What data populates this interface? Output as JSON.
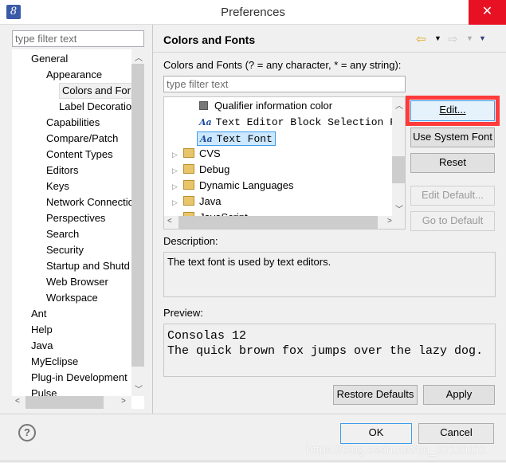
{
  "window": {
    "title": "Preferences",
    "close_icon": "close-icon"
  },
  "left": {
    "filter_placeholder": "type filter text",
    "items": [
      {
        "label": "General",
        "level": 0
      },
      {
        "label": "Appearance",
        "level": 1
      },
      {
        "label": "Colors and For",
        "level": 2,
        "selected": true
      },
      {
        "label": "Label Decoratio",
        "level": 2
      },
      {
        "label": "Capabilities",
        "level": 1
      },
      {
        "label": "Compare/Patch",
        "level": 1
      },
      {
        "label": "Content Types",
        "level": 1
      },
      {
        "label": "Editors",
        "level": 1
      },
      {
        "label": "Keys",
        "level": 1
      },
      {
        "label": "Network Connectio",
        "level": 1
      },
      {
        "label": "Perspectives",
        "level": 1
      },
      {
        "label": "Search",
        "level": 1
      },
      {
        "label": "Security",
        "level": 1
      },
      {
        "label": "Startup and Shutd",
        "level": 1
      },
      {
        "label": "Web Browser",
        "level": 1
      },
      {
        "label": "Workspace",
        "level": 1
      },
      {
        "label": "Ant",
        "level": 0
      },
      {
        "label": "Help",
        "level": 0
      },
      {
        "label": "Java",
        "level": 0
      },
      {
        "label": "MyEclipse",
        "level": 0
      },
      {
        "label": "Plug-in Development",
        "level": 0
      },
      {
        "label": "Pulse",
        "level": 0
      }
    ]
  },
  "right": {
    "header": "Colors and Fonts",
    "filter_label": "Colors and Fonts (? = any character, * = any string):",
    "filter_placeholder": "type filter text",
    "tree": [
      {
        "label": "Qualifier information color",
        "type": "color"
      },
      {
        "label": "Text Editor Block Selection Font",
        "type": "font"
      },
      {
        "label": "Text Font",
        "type": "font",
        "selected": true
      },
      {
        "label": "CVS",
        "type": "category"
      },
      {
        "label": "Debug",
        "type": "category"
      },
      {
        "label": "Dynamic Languages",
        "type": "category"
      },
      {
        "label": "Java",
        "type": "category"
      },
      {
        "label": "JavaScript",
        "type": "category"
      }
    ],
    "buttons": {
      "edit": "Edit...",
      "use_system_font": "Use System Font",
      "reset": "Reset",
      "edit_default": "Edit Default...",
      "go_to_default": "Go to Default"
    },
    "description_label": "Description:",
    "description_text": "The text font is used by text editors.",
    "preview_label": "Preview:",
    "preview_lines": [
      "Consolas 12",
      "The quick brown fox jumps over the lazy dog."
    ],
    "restore_defaults": "Restore Defaults",
    "apply": "Apply"
  },
  "footer": {
    "ok": "OK",
    "cancel": "Cancel",
    "watermark": "https://blog.csdn.net/qq_37131111"
  },
  "colors": {
    "highlight": "#ff3b3b",
    "selection": "#cce8ff"
  }
}
